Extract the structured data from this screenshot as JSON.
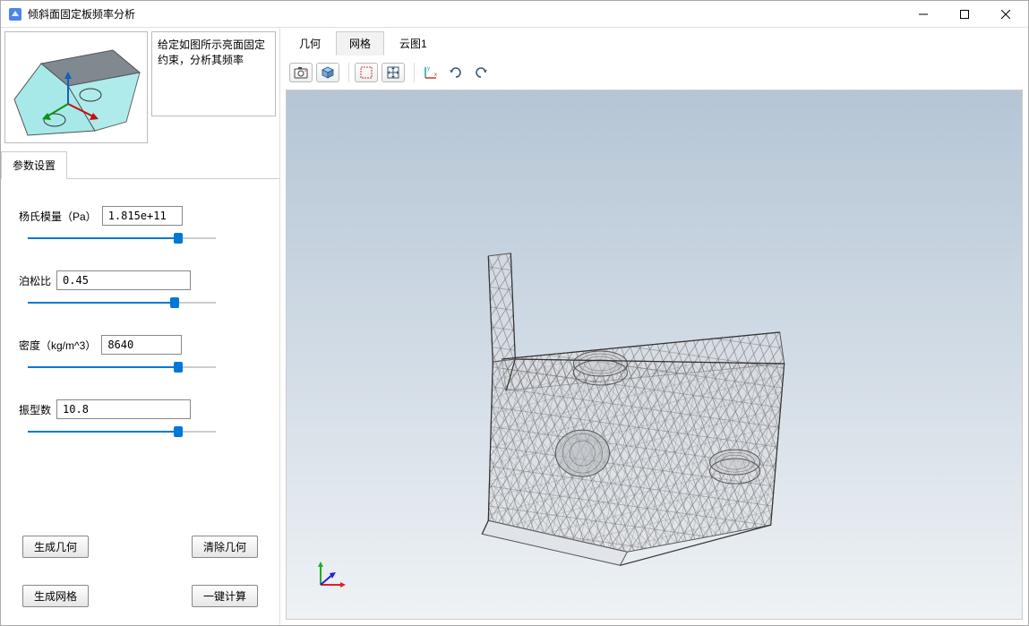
{
  "window": {
    "title": "倾斜面固定板频率分析"
  },
  "left": {
    "description": "给定如图所示亮面固定约束，分析其频率",
    "tab_label": "参数设置",
    "params": {
      "youngs_modulus": {
        "label": "杨氏模量（Pa）",
        "value": "1.815e+11",
        "slider_pct": 80
      },
      "poisson": {
        "label": "泊松比",
        "value": "0.45",
        "slider_pct": 78
      },
      "density": {
        "label": "密度（kg/m^3）",
        "value": "8640",
        "slider_pct": 80
      },
      "mode_count": {
        "label": "振型数",
        "value": "10.8",
        "slider_pct": 80
      }
    },
    "buttons": {
      "gen_geometry": "生成几何",
      "clear_geometry": "清除几何",
      "gen_mesh": "生成网格",
      "compute": "一键计算"
    }
  },
  "view": {
    "tabs": [
      {
        "label": "几何",
        "active": false
      },
      {
        "label": "网格",
        "active": true
      },
      {
        "label": "云图1",
        "active": false
      }
    ],
    "toolbar_icons": [
      "camera-icon",
      "isometric-cube-icon",
      "select-rect-icon",
      "fit-view-icon",
      "xy-axis-icon",
      "rotate-cw-icon",
      "rotate-ccw-icon"
    ]
  },
  "colors": {
    "accent": "#0078d7",
    "mesh_line": "#888888",
    "thumb_face": "#a7e9e9",
    "thumb_side": "#808890"
  }
}
